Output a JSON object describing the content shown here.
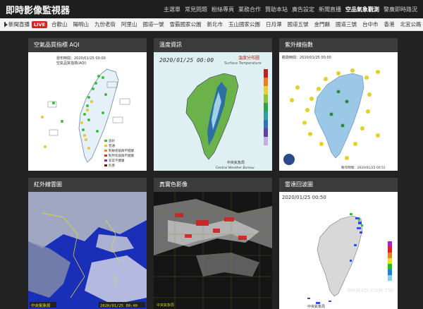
{
  "app": {
    "title": "即時影像監視器"
  },
  "top_nav": [
    "主選單",
    "常見問題",
    "粉絲專頁",
    "業務合作",
    "贊助本站",
    "廣告設定",
    "新聞直播",
    "空品氣象觀測",
    "警廣即時路況"
  ],
  "top_nav_active": "空品氣象觀測",
  "sub_nav": {
    "first": "新聞直播",
    "live_badge": "LIVE",
    "items": [
      "合歡山",
      "陽明山",
      "九份老街",
      "阿里山",
      "國道一號",
      "雪霸國家公園",
      "新北市",
      "玉山國家公園",
      "日月潭",
      "國道五號",
      "金門縣",
      "國道三號",
      "台中市",
      "香港",
      "北宜公路"
    ]
  },
  "cards": [
    {
      "title": "空氣品質指標 AQI",
      "caption": "發布時間：2020/01/25 00:00",
      "caption2": "空氣品質指標(AQI)",
      "legend": [
        "良好",
        "普通",
        "對敏感族群不健康",
        "對所有族群不健康",
        "非常不健康",
        "危害"
      ]
    },
    {
      "title": "溫度資訊",
      "date": "2020/01/25 00:00",
      "map_title": "溫度分布圖",
      "map_subtitle": "Surface Temperature",
      "agency": "中央氣象局",
      "agency_en": "Central Weather Bureau"
    },
    {
      "title": "紫外線指數",
      "caption": "觀測時間：2020/01/25 00:00",
      "footer": "製作時間：2020/01/25 00:51"
    },
    {
      "title": "紅外線雲圖",
      "stamp": "2020/01/25 00:40",
      "agency": "中央氣象局"
    },
    {
      "title": "真實色影像",
      "agency": "中央氣象局"
    },
    {
      "title": "雷達回波圖",
      "date": "2020/01/25 00:50",
      "agency": "中央氣象局"
    }
  ],
  "watermark": "MRMAD.COM.TW",
  "colors": {
    "topbar": "#1e1e1e",
    "subbar": "#f4f4f4",
    "live": "#e02020",
    "page": "#222222",
    "card": "#3a3a3a"
  }
}
